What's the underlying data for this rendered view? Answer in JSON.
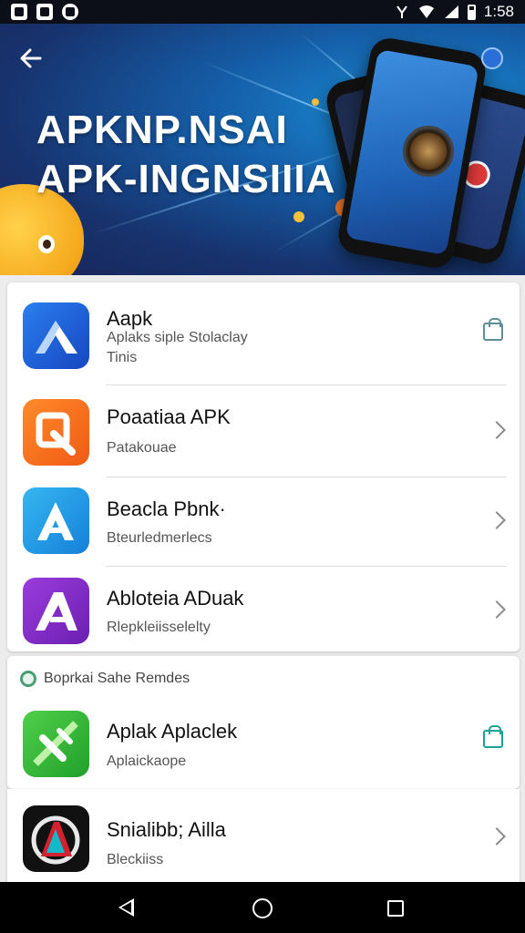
{
  "status_bar": {
    "time": "1:58",
    "icons": [
      "gallery-icon",
      "photo-icon",
      "whatsapp-icon",
      "hotspot-icon",
      "wifi-icon",
      "signal-icon",
      "battery-icon"
    ]
  },
  "banner": {
    "title_line1": "APKNP.NSAI",
    "title_line2": "APK-INGNSIIIA",
    "back_icon": "arrow-left-icon"
  },
  "apps": [
    {
      "name": "Aapk",
      "subtitle": "Aplaks siple Stolaclay\nTinis",
      "action": "bag-icon",
      "icon_colors": [
        "#2b7ff0",
        "#1646c0"
      ]
    },
    {
      "name": "Poaatiaa APK",
      "subtitle": "Patakouae",
      "action": "chevron-right-icon",
      "icon_colors": [
        "#ff8a2a",
        "#f05a14"
      ]
    },
    {
      "name": "Beacla Pbnk·",
      "subtitle": "Bteurledmerlecs",
      "action": "chevron-right-icon",
      "icon_colors": [
        "#36b6f2",
        "#1580d8"
      ]
    },
    {
      "name": "Abloteia ADuak",
      "subtitle": "Rlepkleiisselelty",
      "action": "chevron-right-icon",
      "icon_colors": [
        "#9a3cdc",
        "#6c1fb2"
      ]
    }
  ],
  "section": {
    "header": "Boprkai Sahe Remdes",
    "apps": [
      {
        "name": "Aplak Aplaclek",
        "subtitle": "Aplaickaope",
        "action": "bag-icon",
        "icon_colors": [
          "#4fcf4a",
          "#21a02a"
        ]
      },
      {
        "name": "Snialibb; Ailla",
        "subtitle": "Bleckiiss",
        "action": "chevron-right-icon",
        "icon_colors": [
          "#111111",
          "#d42030"
        ]
      }
    ]
  },
  "nav": {
    "icons": [
      "back-triangle-icon",
      "home-circle-icon",
      "recents-square-icon"
    ]
  }
}
